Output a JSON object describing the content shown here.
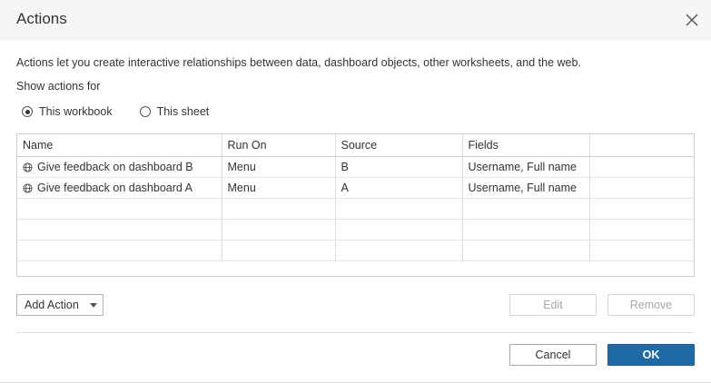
{
  "dialog": {
    "title": "Actions",
    "description": "Actions let you create interactive relationships between data, dashboard objects, other worksheets, and the web.",
    "show_actions_label": "Show actions for"
  },
  "scope": {
    "options": [
      {
        "label": "This workbook",
        "selected": true
      },
      {
        "label": "This sheet",
        "selected": false
      }
    ]
  },
  "table": {
    "columns": [
      "Name",
      "Run On",
      "Source",
      "Fields",
      ""
    ],
    "rows": [
      {
        "icon": "globe-icon",
        "name": "Give feedback on dashboard B",
        "run_on": "Menu",
        "source": "B",
        "fields": "Username, Full name"
      },
      {
        "icon": "globe-icon",
        "name": "Give feedback on dashboard A",
        "run_on": "Menu",
        "source": "A",
        "fields": "Username, Full name"
      }
    ]
  },
  "buttons": {
    "add_action": "Add Action",
    "edit": "Edit",
    "remove": "Remove",
    "cancel": "Cancel",
    "ok": "OK"
  },
  "colors": {
    "primary": "#1f6aa5",
    "title_bar_bg": "#f5f5f5",
    "disabled_text": "#a9a9a9"
  }
}
